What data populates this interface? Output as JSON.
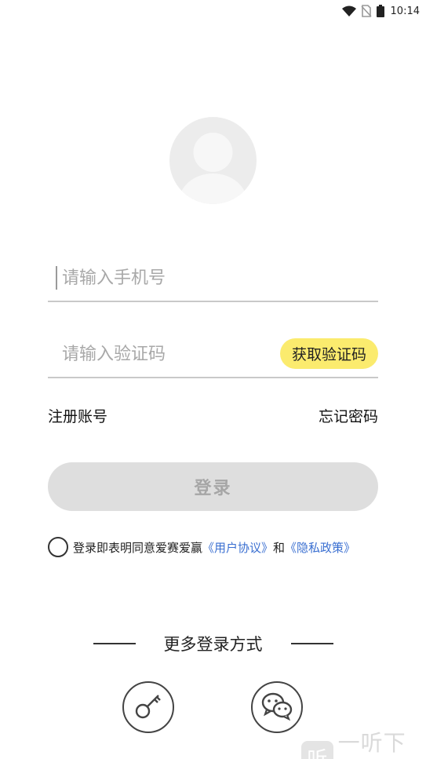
{
  "status_bar": {
    "time": "10:14",
    "icons": [
      "wifi-icon",
      "no-sim-icon",
      "battery-icon"
    ]
  },
  "avatar": {
    "icon": "user-avatar-icon"
  },
  "phone_input": {
    "placeholder": "请输入手机号",
    "value": ""
  },
  "code_input": {
    "placeholder": "请输入验证码",
    "value": ""
  },
  "get_code_label": "获取验证码",
  "links": {
    "register": "注册账号",
    "forgot": "忘记密码"
  },
  "login_label": "登录",
  "agreement": {
    "prefix": "登录即表明同意爱赛爱赢",
    "user_agreement": "《用户协议》",
    "and": "和",
    "privacy_policy": "《隐私政策》",
    "checked": false
  },
  "more_login": {
    "title": "更多登录方式"
  },
  "social": [
    {
      "name": "key-login",
      "icon": "key-icon"
    },
    {
      "name": "wechat-login",
      "icon": "wechat-icon"
    }
  ],
  "watermark": {
    "logo": "听",
    "text": "一听下载"
  },
  "colors": {
    "accent": "#fbeb6e",
    "link": "#3a6fd1",
    "button_disabled": "#dedede",
    "button_text_disabled": "#a6a6a6",
    "divider": "#c9c9c9"
  }
}
